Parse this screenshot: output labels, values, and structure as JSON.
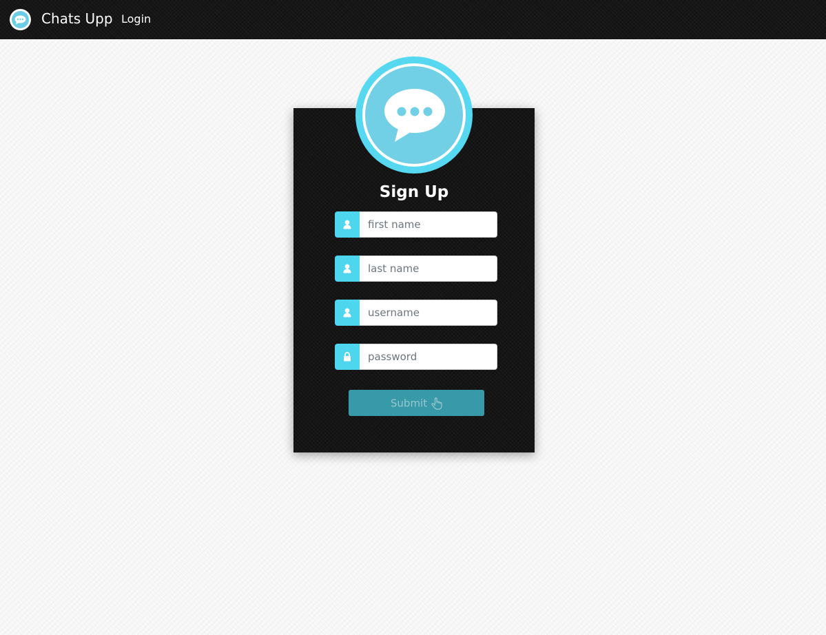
{
  "navbar": {
    "brand_name": "Chats Upp",
    "login_label": "Login"
  },
  "signup": {
    "title": "Sign Up",
    "fields": [
      {
        "name": "first_name",
        "placeholder": "first name",
        "value": "",
        "icon": "user-icon"
      },
      {
        "name": "last_name",
        "placeholder": "last name",
        "value": "",
        "icon": "user-icon"
      },
      {
        "name": "username",
        "placeholder": "username",
        "value": "",
        "icon": "user-icon"
      },
      {
        "name": "password",
        "placeholder": "password",
        "value": "",
        "icon": "lock-icon"
      }
    ],
    "submit_label": "Submit",
    "submit_icon": "hand-pointer-icon"
  },
  "colors": {
    "accent": "#4fd6ef",
    "logo_fill": "#71cfe6",
    "submit_bg": "#3aa1b1",
    "card_bg": "#151515",
    "navbar_bg": "#161616"
  }
}
